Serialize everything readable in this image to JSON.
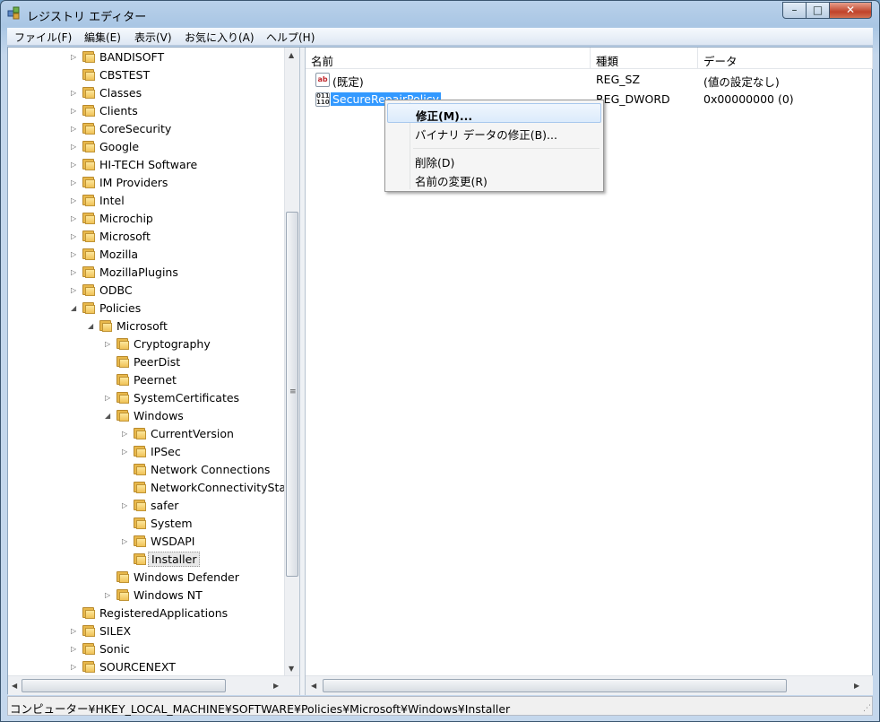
{
  "window": {
    "title": "レジストリ エディター",
    "controls": {
      "minimize": "–",
      "maximize": "□",
      "close": "✕"
    }
  },
  "menubar": {
    "items": [
      {
        "label": "ファイル(F)"
      },
      {
        "label": "編集(E)"
      },
      {
        "label": "表示(V)"
      },
      {
        "label": "お気に入り(A)"
      },
      {
        "label": "ヘルプ(H)"
      }
    ]
  },
  "tree": {
    "nodes": [
      {
        "label": "BANDISOFT",
        "level": 0,
        "expander": "collapsed"
      },
      {
        "label": "CBSTEST",
        "level": 0,
        "expander": "none"
      },
      {
        "label": "Classes",
        "level": 0,
        "expander": "collapsed"
      },
      {
        "label": "Clients",
        "level": 0,
        "expander": "collapsed"
      },
      {
        "label": "CoreSecurity",
        "level": 0,
        "expander": "collapsed"
      },
      {
        "label": "Google",
        "level": 0,
        "expander": "collapsed"
      },
      {
        "label": "HI-TECH Software",
        "level": 0,
        "expander": "collapsed"
      },
      {
        "label": "IM Providers",
        "level": 0,
        "expander": "collapsed"
      },
      {
        "label": "Intel",
        "level": 0,
        "expander": "collapsed"
      },
      {
        "label": "Microchip",
        "level": 0,
        "expander": "collapsed"
      },
      {
        "label": "Microsoft",
        "level": 0,
        "expander": "collapsed"
      },
      {
        "label": "Mozilla",
        "level": 0,
        "expander": "collapsed"
      },
      {
        "label": "MozillaPlugins",
        "level": 0,
        "expander": "collapsed"
      },
      {
        "label": "ODBC",
        "level": 0,
        "expander": "collapsed"
      },
      {
        "label": "Policies",
        "level": 0,
        "expander": "expanded"
      },
      {
        "label": "Microsoft",
        "level": 1,
        "expander": "expanded"
      },
      {
        "label": "Cryptography",
        "level": 2,
        "expander": "collapsed"
      },
      {
        "label": "PeerDist",
        "level": 2,
        "expander": "none"
      },
      {
        "label": "Peernet",
        "level": 2,
        "expander": "none"
      },
      {
        "label": "SystemCertificates",
        "level": 2,
        "expander": "collapsed"
      },
      {
        "label": "Windows",
        "level": 2,
        "expander": "expanded"
      },
      {
        "label": "CurrentVersion",
        "level": 3,
        "expander": "collapsed"
      },
      {
        "label": "IPSec",
        "level": 3,
        "expander": "collapsed"
      },
      {
        "label": "Network Connections",
        "level": 3,
        "expander": "none"
      },
      {
        "label": "NetworkConnectivityStat",
        "level": 3,
        "expander": "none"
      },
      {
        "label": "safer",
        "level": 3,
        "expander": "collapsed"
      },
      {
        "label": "System",
        "level": 3,
        "expander": "none"
      },
      {
        "label": "WSDAPI",
        "level": 3,
        "expander": "collapsed"
      },
      {
        "label": "Installer",
        "level": 3,
        "expander": "none",
        "selected": true
      },
      {
        "label": "Windows Defender",
        "level": 2,
        "expander": "none"
      },
      {
        "label": "Windows NT",
        "level": 2,
        "expander": "collapsed"
      },
      {
        "label": "RegisteredApplications",
        "level": 0,
        "expander": "none"
      },
      {
        "label": "SILEX",
        "level": 0,
        "expander": "collapsed"
      },
      {
        "label": "Sonic",
        "level": 0,
        "expander": "collapsed"
      },
      {
        "label": "SOURCENEXT",
        "level": 0,
        "expander": "collapsed"
      }
    ]
  },
  "list": {
    "columns": [
      {
        "label": "名前"
      },
      {
        "label": "種類"
      },
      {
        "label": "データ"
      }
    ],
    "rows": [
      {
        "icon": "ab",
        "name": "(既定)",
        "type": "REG_SZ",
        "data": "(値の設定なし)",
        "selected": false
      },
      {
        "icon": "dword",
        "name": "SecureRepairPolicy",
        "type": "REG_DWORD",
        "data": "0x00000000 (0)",
        "selected": true
      }
    ]
  },
  "context_menu": {
    "items": [
      {
        "label": "修正(M)...",
        "default": true
      },
      {
        "label": "バイナリ データの修正(B)..."
      },
      {
        "label": "削除(D)"
      },
      {
        "label": "名前の変更(R)"
      }
    ]
  },
  "statusbar": {
    "path": "コンピューター¥HKEY_LOCAL_MACHINE¥SOFTWARE¥Policies¥Microsoft¥Windows¥Installer"
  },
  "colors": {
    "selection": "#3399ff",
    "folder": "#f0c257"
  }
}
